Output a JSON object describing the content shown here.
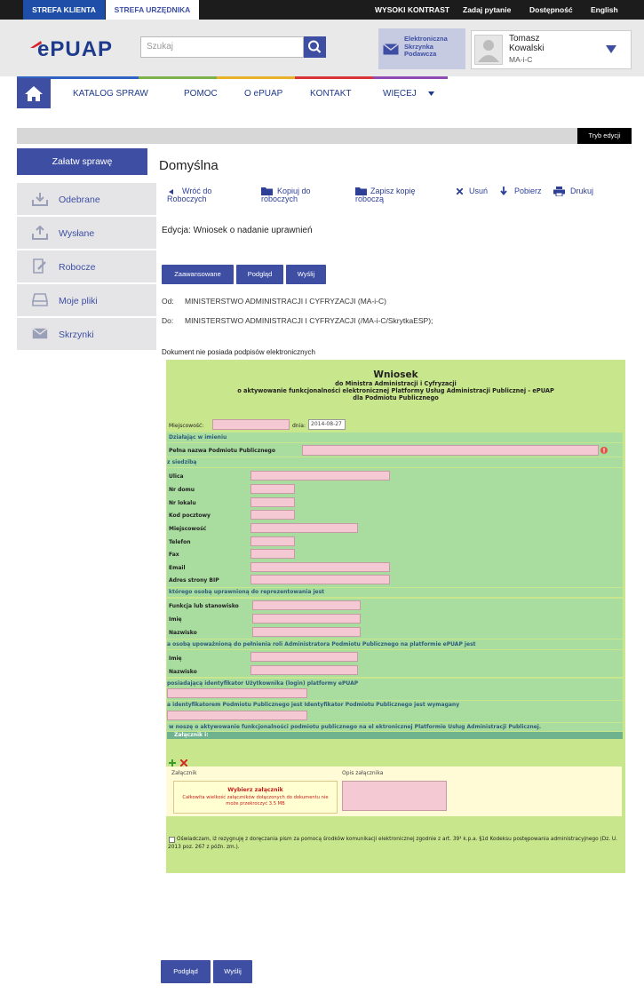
{
  "topbar": {
    "tab_client": "STREFA KLIENTA",
    "tab_official": "STREFA URZĘDNIKA",
    "high_contrast": "WYSOKI KONTRAST",
    "ask": "Zadaj pytanie",
    "accessibility": "Dostępność",
    "english": "English"
  },
  "header": {
    "logo": "ePUAP",
    "search_placeholder": "Szukaj",
    "esp_label": "Elektroniczna Skrzynka Podawcza",
    "user_name": "Tomasz Kowalski",
    "user_role": "MA-i-C"
  },
  "nav": {
    "items": [
      "KATALOG SPRAW",
      "POMOC",
      "O ePUAP",
      "KONTAKT",
      "WIĘCEJ"
    ]
  },
  "edit_mode": "Tryb edycji",
  "sidebar": {
    "primary": "Załatw sprawę",
    "items": [
      "Odebrane",
      "Wysłane",
      "Robocze",
      "Moje pliki",
      "Skrzynki"
    ]
  },
  "main": {
    "title": "Domyślna",
    "actions": {
      "back": "Wróć do Roboczych",
      "copy": "Kopiuj do roboczych",
      "save_copy": "Zapisz kopię roboczą",
      "delete": "Usuń",
      "download": "Pobierz",
      "print": "Drukuj"
    },
    "edit_label": "Edycja: Wniosek o nadanie uprawnień",
    "buttons": {
      "advanced": "Zaawansowane",
      "preview": "Podgląd",
      "send": "Wyślij"
    },
    "from_label": "Od:",
    "from_value": "MINISTERSTWO ADMINISTRACJI I CYFRYZACJI (MA-i-C)",
    "to_label": "Do:",
    "to_value": "MINISTERSTWO ADMINISTRACJI I CYFRYZACJI (/MA-i-C/SkrytkaESP);",
    "no_signatures": "Dokument nie posiada podpisów elektronicznych"
  },
  "form": {
    "heading": "Wniosek",
    "sub1": "do Ministra Administracji i Cyfryzacji",
    "sub2": "o aktywowanie funkcjonalności elektronicznej Platformy Usług Administracji Publicznej - ePUAP",
    "sub3": "dla Podmiotu Publicznego",
    "place_label": "Miejscowość:",
    "date_label": "dnia:",
    "date_value": "2014-08-27",
    "sec_acting": "Działając w imieniu",
    "full_name_label": "Pełna nazwa Podmiotu Publicznego",
    "sec_seat": "z siedzibą",
    "addr_labels": [
      "Ulica",
      "Nr domu",
      "Nr lokalu",
      "Kod pocztowy",
      "Miejscowość",
      "Telefon",
      "Fax",
      "Email",
      "Adres strony BIP"
    ],
    "sec_representative": "którego osobą uprawnioną do reprezentowania jest",
    "rep_labels": [
      "Funkcja lub stanowisko",
      "Imię",
      "Nazwisko"
    ],
    "sec_admin": "a osobą upoważnioną do pełnienia roli Administratora Podmiotu Publicznego na platformie ePUAP jest",
    "admin_labels": [
      "Imię",
      "Nazwisko"
    ],
    "sec_login": "posiadającą identyfikator Użytkownika (login) platformy ePUAP",
    "sec_identifier": "a identyfikatorem Podmiotu Publicznego jest Identyfikator Podmiotu Publicznego jest wymagany",
    "sec_request": "w noszę o aktywowanie funkcjonalności podmiotu publicznego na el ektronicznej Platformie Usług Administracji Publicznej.",
    "sec_attachment": "Załącznik i:",
    "col_attachment": "Załącznik",
    "col_description": "Opis załącznika",
    "choose_attachment": "Wybierz załącznik",
    "size_note": "Całkowita wielkość załączników dołączonych do dokumentu nie może przekroczyć 3.5 MB",
    "declaration": "Oświadczam, iż rezygnuję z doręczania pism za pomocą środków komunikacji elektronicznej zgodnie z art. 39¹ k.p.a. §1d Kodeksu postępowania administracyjnego (Dz. U. 2013 poz. 267 z późn. zm.)."
  },
  "footer_buttons": {
    "preview": "Podgląd",
    "send": "Wyślij"
  },
  "colors": {
    "brand_blue": "#3e4fa3",
    "form_green": "#c8e68b",
    "field_pink": "#f5c9d3",
    "stripe": [
      "#2f62c2",
      "#7db24a",
      "#e8b32a",
      "#d8353a",
      "#8e4bb4"
    ]
  }
}
